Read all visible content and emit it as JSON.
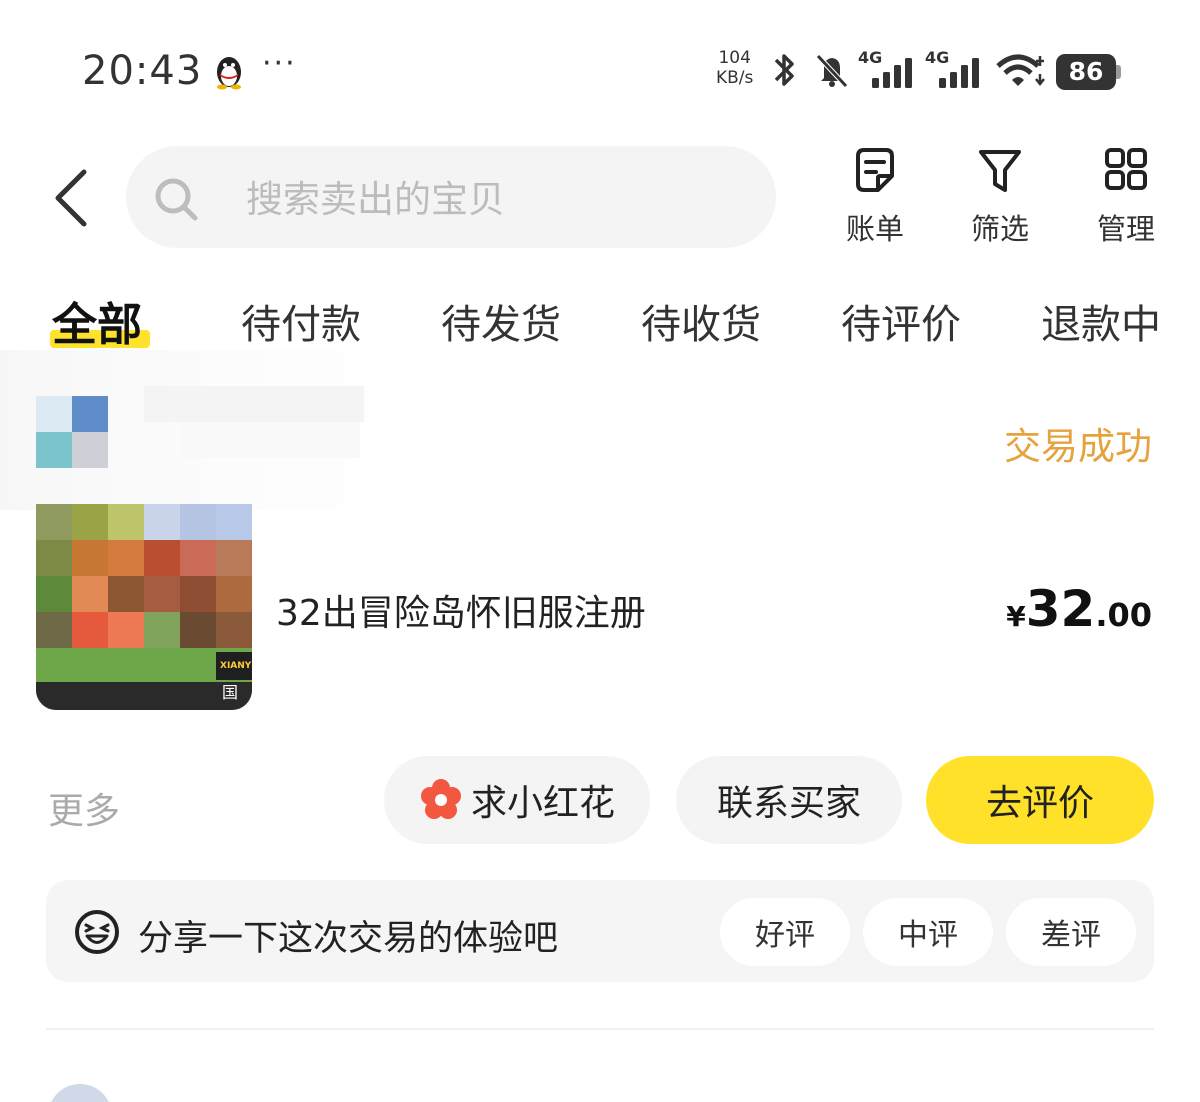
{
  "status_bar": {
    "time": "20:43",
    "more_dots": "···",
    "net_speed_value": "104",
    "net_speed_unit": "KB/s",
    "signal_label_1": "4G",
    "signal_label_2": "4G",
    "battery": "86",
    "icons": [
      "qq-penguin-icon",
      "bluetooth-icon",
      "mute-bell-icon",
      "signal-icon",
      "signal-icon",
      "wifi-icon",
      "battery-icon"
    ]
  },
  "header": {
    "search_placeholder": "搜索卖出的宝贝",
    "bill_label": "账单",
    "filter_label": "筛选",
    "manage_label": "管理"
  },
  "tabs": [
    {
      "label": "全部",
      "active": true
    },
    {
      "label": "待付款"
    },
    {
      "label": "待发货"
    },
    {
      "label": "待收货"
    },
    {
      "label": "待评价"
    },
    {
      "label": "退款中"
    }
  ],
  "order": {
    "status": "交易成功",
    "title": "32出冒险岛怀旧服注册",
    "price_currency": "¥",
    "price_integer": "32",
    "price_decimal": ".00",
    "image_text_1": "XIANY",
    "image_text_2": "国"
  },
  "actions": {
    "more": "更多",
    "flower": "求小红花",
    "contact": "联系买家",
    "review": "去评价"
  },
  "review_prompt": {
    "text": "分享一下这次交易的体验吧",
    "good": "好评",
    "neutral": "中评",
    "bad": "差评"
  },
  "colors": {
    "accent_yellow": "#ffe12a",
    "status_orange": "#e6a23c",
    "pill_bg": "#f4f4f4"
  }
}
